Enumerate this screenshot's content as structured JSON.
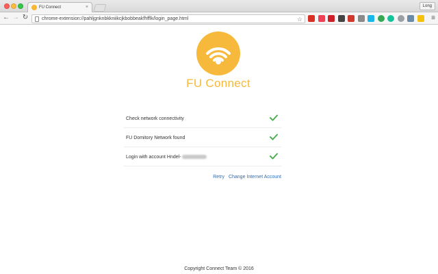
{
  "browser": {
    "profile": "Long",
    "tab": {
      "title": "FU Connect"
    },
    "address_bar": {
      "url": "chrome-extension://pahljgnknbkkniikcjkbobbeakfhfflk/login_page.html"
    },
    "extension_icons": [
      "gmail-icon",
      "pocket-icon",
      "opera-icon",
      "buffer-icon",
      "red-extension-icon",
      "grid-extension-icon",
      "vimeo-icon",
      "green-extension-icon",
      "grammarly-icon",
      "ghostery-icon",
      "chrome-extension-icon",
      "yellow-extension-icon"
    ],
    "extension_colors": [
      "#d93025",
      "#ee4056",
      "#cc1f2a",
      "#444444",
      "#d0392b",
      "#8a8a8a",
      "#1ab7ea",
      "#34a853",
      "#15c39a",
      "#9aa0a6",
      "#6a8ca8",
      "#f4c20d"
    ]
  },
  "app": {
    "title": "FU Connect",
    "brand_color": "#f6b93b"
  },
  "checks": [
    {
      "label": "Check network connectivity",
      "status": "done"
    },
    {
      "label": "FU Domitory Network found",
      "status": "done"
    },
    {
      "label": "Login with account Hndel-",
      "status": "done"
    }
  ],
  "check_color": "#4caf50",
  "actions": {
    "retry": "Retry",
    "change_account": "Change Internet Account"
  },
  "footer": {
    "copyright": "Copyright Connect Team © 2016"
  }
}
